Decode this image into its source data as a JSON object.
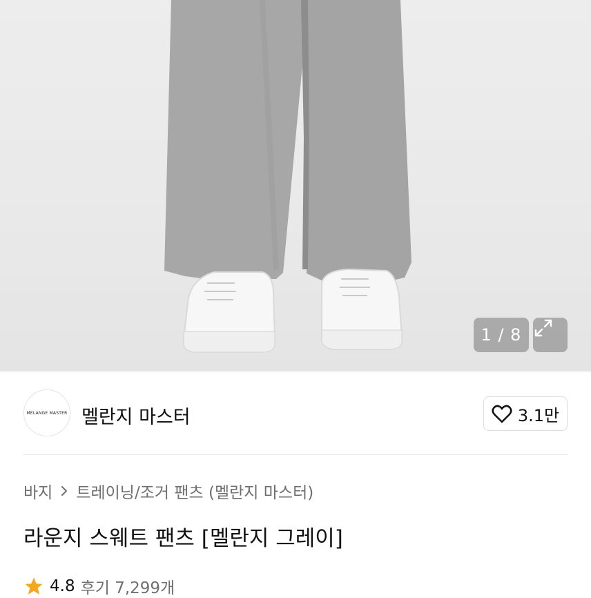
{
  "gallery": {
    "counter": "1 / 8",
    "expand_icon": "expand-arrows-icon"
  },
  "brand": {
    "logo_text": "MELANGE MASTER",
    "name": "멜란지 마스터",
    "like_icon": "heart-outline-icon",
    "like_count": "3.1만"
  },
  "breadcrumb": {
    "category": "바지",
    "separator_icon": "chevron-right-icon",
    "subcategory": "트레이닝/조거 팬츠 (멜란지 마스터)"
  },
  "product": {
    "title": "라운지 스웨트 팬츠 [멜란지 그레이]",
    "rating": "4.8",
    "reviews": "후기 7,299개"
  },
  "colors": {
    "star": "#f5a623",
    "pants": "#a9a9a9"
  }
}
